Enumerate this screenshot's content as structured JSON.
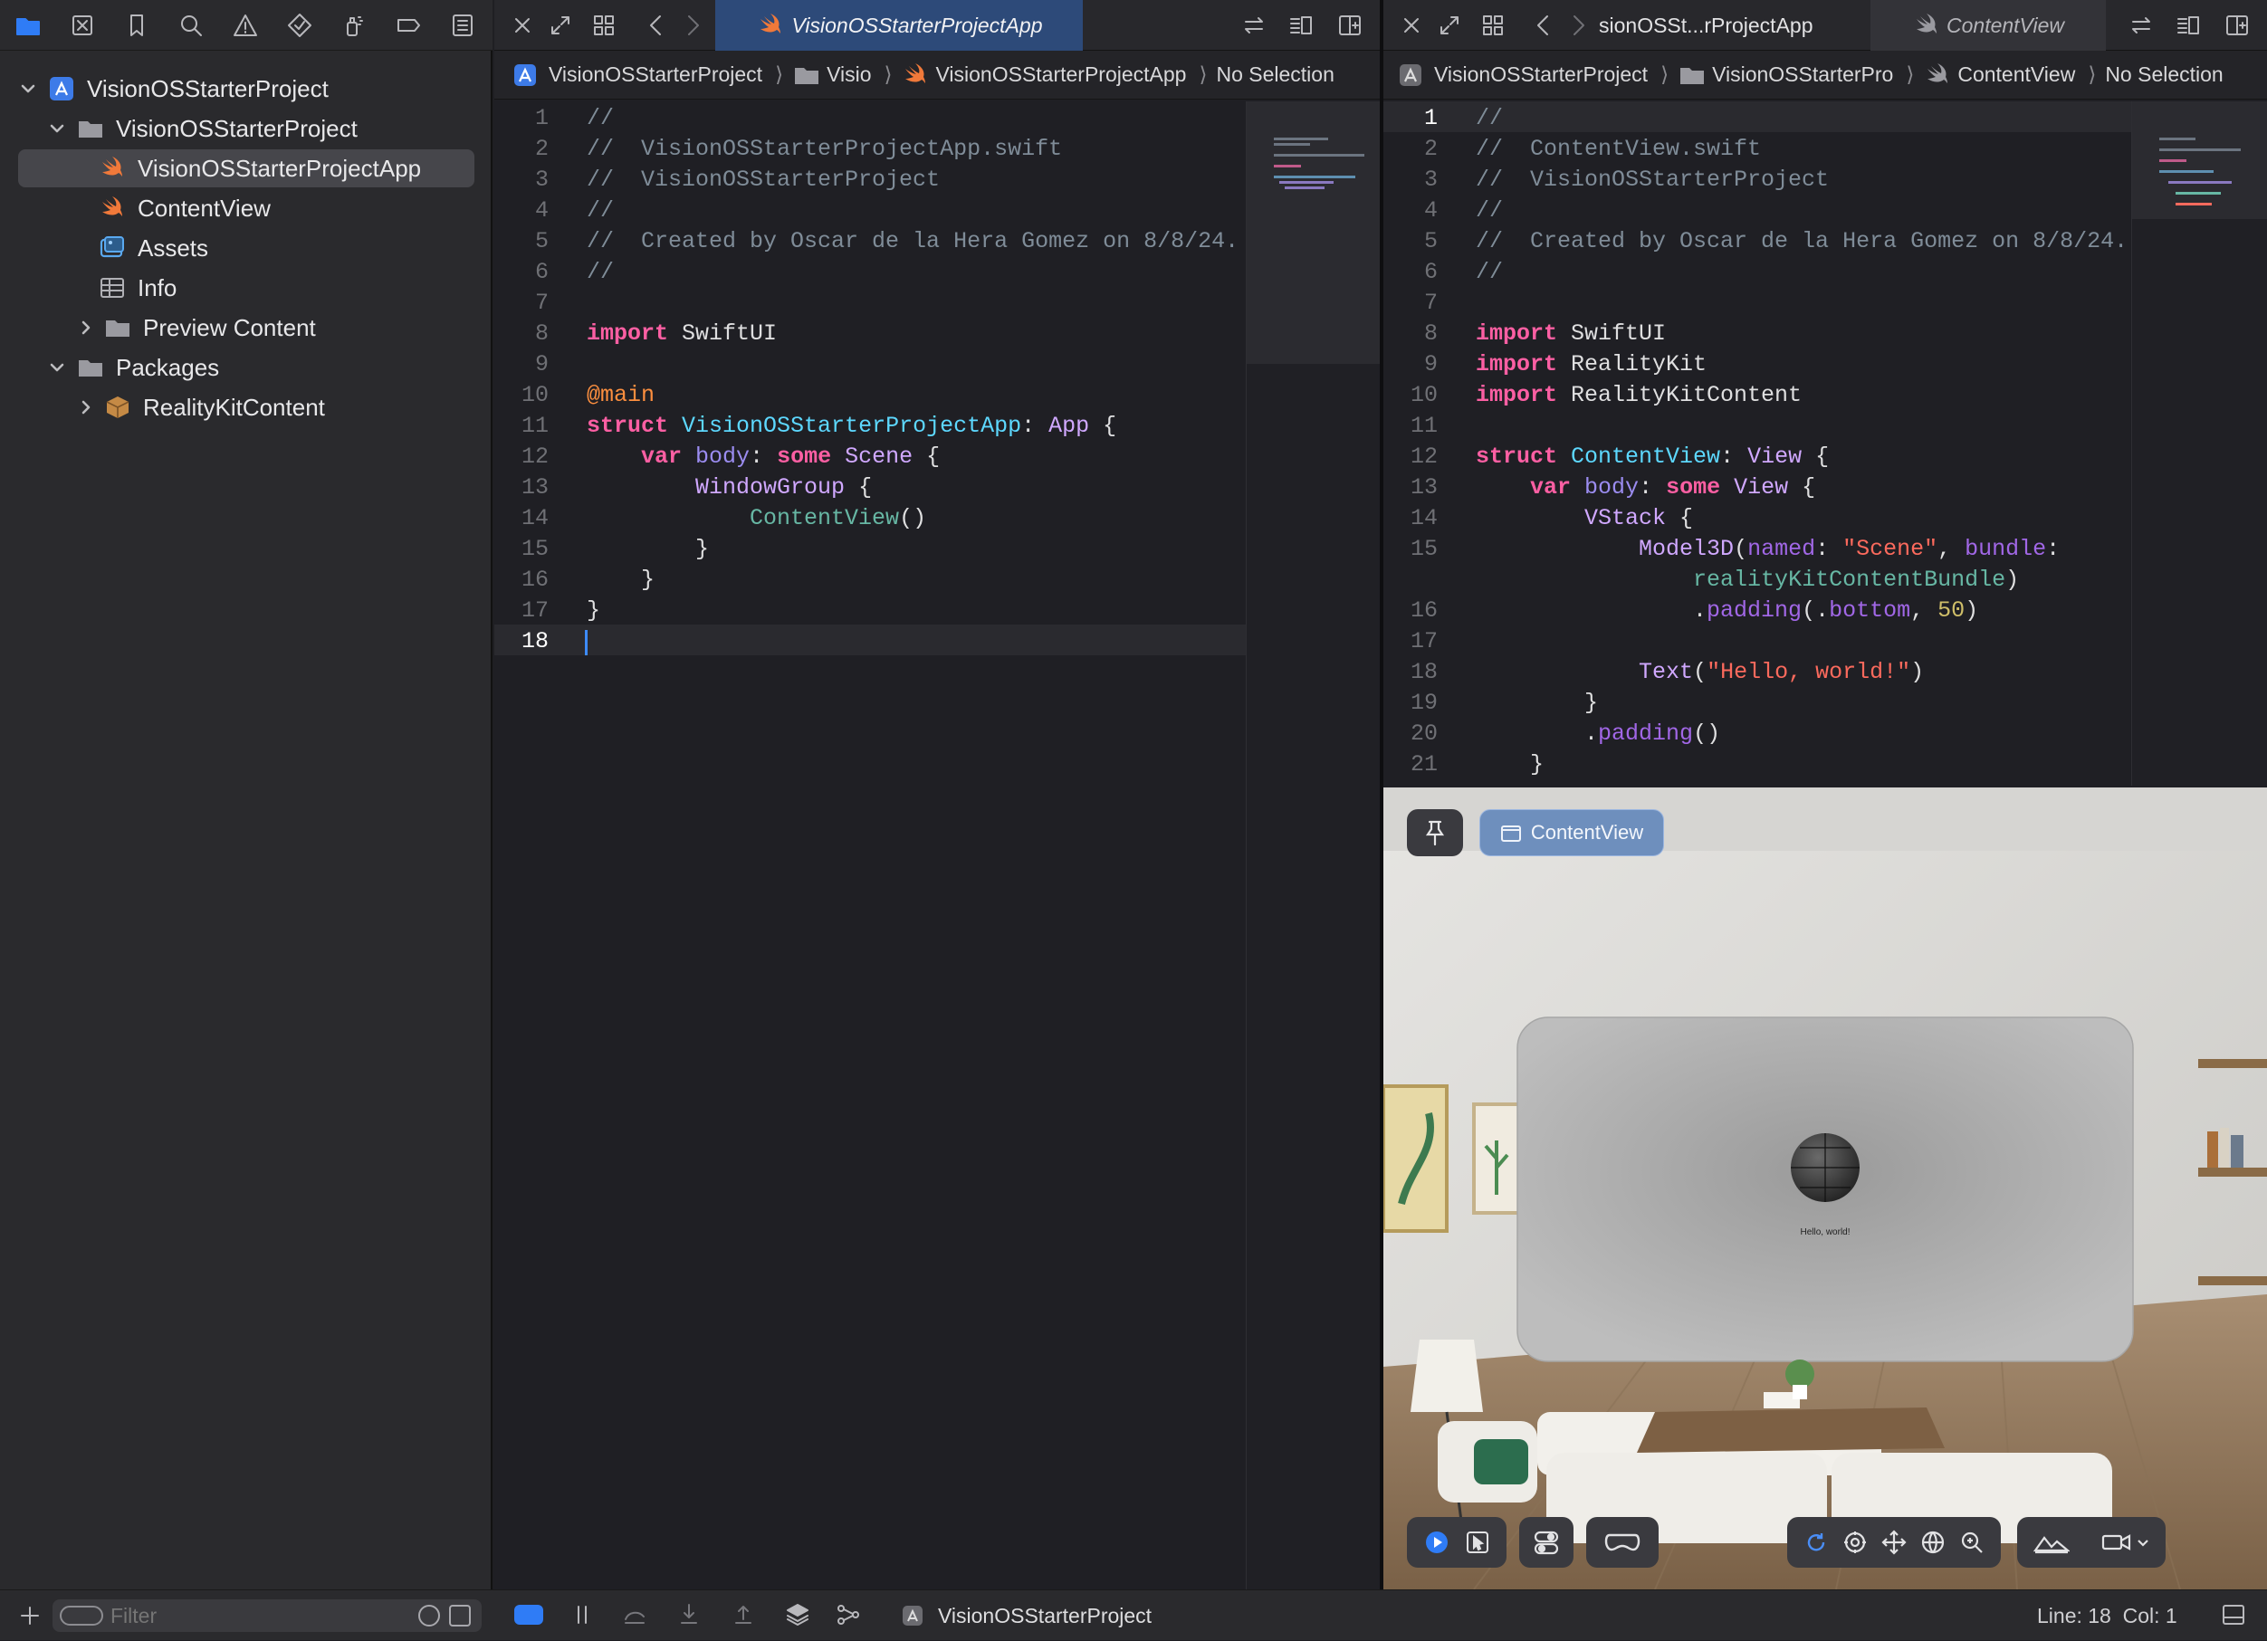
{
  "navigator": {
    "tree": [
      {
        "label": "VisionOSStarterProject",
        "icon": "project-icon",
        "expanded": true
      },
      {
        "label": "VisionOSStarterProject",
        "icon": "folder-icon",
        "expanded": true
      },
      {
        "label": "VisionOSStarterProjectApp",
        "icon": "swift-file-icon",
        "selected": true
      },
      {
        "label": "ContentView",
        "icon": "swift-file-icon"
      },
      {
        "label": "Assets",
        "icon": "asset-catalog-icon"
      },
      {
        "label": "Info",
        "icon": "plist-icon"
      },
      {
        "label": "Preview Content",
        "icon": "folder-icon",
        "expanded": false
      },
      {
        "label": "Packages",
        "icon": "folder-icon",
        "expanded": true
      },
      {
        "label": "RealityKitContent",
        "icon": "package-icon",
        "expanded": false
      }
    ],
    "filter_placeholder": "Filter"
  },
  "editor_left": {
    "tab_title": "VisionOSStarterProjectApp",
    "jump_bar": [
      "VisionOSStarterProject",
      "Visio",
      "VisionOSStarterProjectApp",
      "No Selection"
    ],
    "line_numbers": [
      "1",
      "2",
      "3",
      "4",
      "5",
      "6",
      "7",
      "8",
      "9",
      "10",
      "11",
      "12",
      "13",
      "14",
      "15",
      "16",
      "17",
      "18"
    ],
    "current_line": "18"
  },
  "editor_right": {
    "tabs": [
      "sionOSSt...rProjectApp",
      "ContentView"
    ],
    "jump_bar": [
      "VisionOSStarterProject",
      "VisionOSStarterPro",
      "ContentView",
      "No Selection"
    ],
    "line_numbers": [
      "1",
      "2",
      "3",
      "4",
      "5",
      "6",
      "7",
      "8",
      "9",
      "10",
      "11",
      "12",
      "13",
      "14",
      "15",
      "",
      "16",
      "17",
      "18",
      "19",
      "20",
      "21"
    ],
    "current_line": "1"
  },
  "preview": {
    "pin_icon": "pin-icon",
    "scheme_label": "ContentView",
    "window_text": "Hello, world!"
  },
  "statusbar": {
    "scheme": "VisionOSStarterProject",
    "position": "Line: 18  Col: 1"
  },
  "colors": {
    "accent": "#2f6fea",
    "selection": "#3a3a3f"
  }
}
